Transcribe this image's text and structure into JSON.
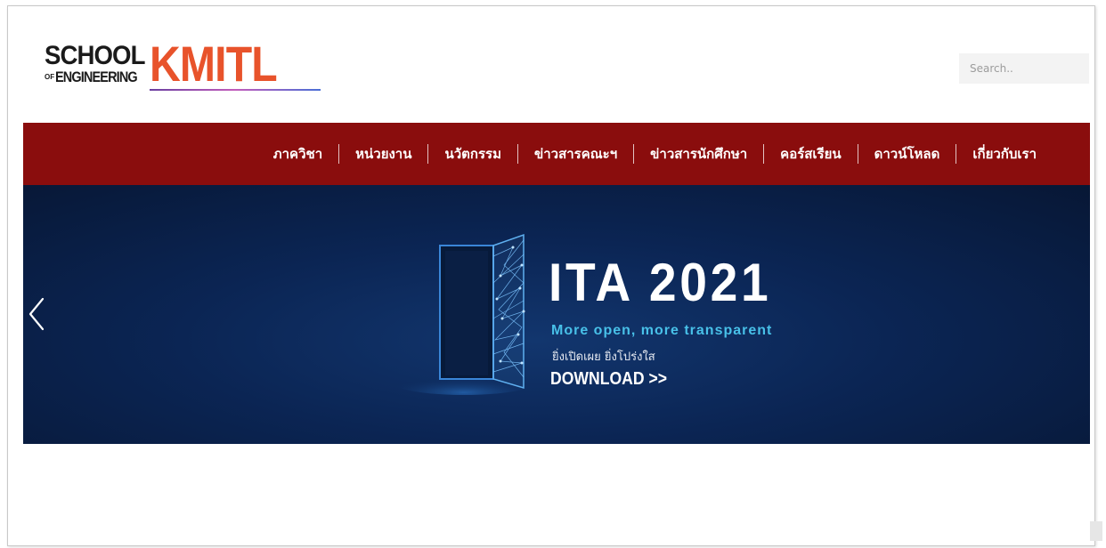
{
  "header": {
    "logo": {
      "school": "SCHOOL",
      "of": "OF",
      "engineering": "ENGINEERING",
      "brand": "KMITL"
    },
    "search_placeholder": "Search.."
  },
  "nav": {
    "items": [
      {
        "label": "ภาควิชา"
      },
      {
        "label": "หน่วยงาน"
      },
      {
        "label": "นวัตกรรม"
      },
      {
        "label": "ข่าวสารคณะฯ"
      },
      {
        "label": "ข่าวสารนักศึกษา"
      },
      {
        "label": "คอร์สเรียน"
      },
      {
        "label": "ดาวน์โหลด"
      },
      {
        "label": "เกี่ยวกับเรา"
      }
    ]
  },
  "banner": {
    "title": "ITA 2021",
    "subtitle": "More open, more transparent",
    "thai_tagline": "ยิ่งเปิดเผย ยิ่งโปร่งใส",
    "cta": "DOWNLOAD >>",
    "prev_icon": "chevron-left-icon"
  },
  "colors": {
    "nav_bg": "#8a0d0d",
    "brand_orange": "#e8532b",
    "banner_bg": "#0b2554",
    "subtitle_cyan": "#48c0e8"
  }
}
